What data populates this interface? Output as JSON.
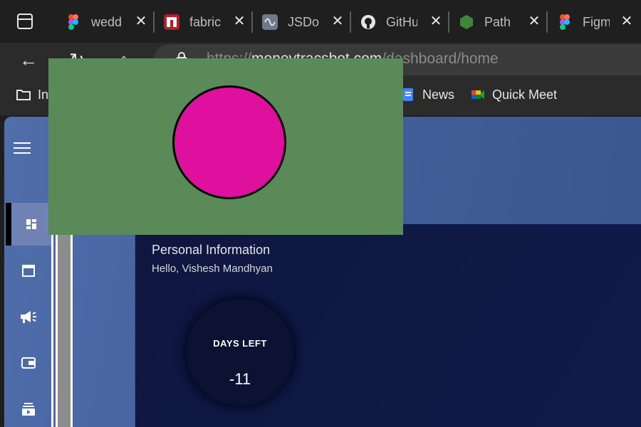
{
  "tabs": [
    {
      "label": "wedding",
      "icon": "figma-icon"
    },
    {
      "label": "fabric",
      "icon": "npm-icon"
    },
    {
      "label": "JSDoc",
      "icon": "jsdoc-icon"
    },
    {
      "label": "GitHub",
      "icon": "github-icon"
    },
    {
      "label": "Path",
      "icon": "nodejs-icon"
    },
    {
      "label": "Figma",
      "icon": "figma-icon"
    }
  ],
  "address_bar": {
    "scheme": "https://",
    "domain": "moneytracsbot.com",
    "path": "/dashboard/home"
  },
  "bookmarks": [
    {
      "label": "In",
      "icon": "folder-icon"
    },
    {
      "label": "News",
      "icon": "google-news-icon"
    },
    {
      "label": "Quick Meet",
      "icon": "google-meet-icon"
    }
  ],
  "sidebar": {
    "items": [
      {
        "name": "dashboard",
        "icon": "dashboard-icon",
        "active": true
      },
      {
        "name": "calendar",
        "icon": "calendar-icon",
        "active": false
      },
      {
        "name": "announcements",
        "icon": "megaphone-icon",
        "active": false
      },
      {
        "name": "wallet",
        "icon": "wallet-icon",
        "active": false
      },
      {
        "name": "subscriptions",
        "icon": "subscriptions-icon",
        "active": false
      }
    ]
  },
  "main": {
    "section_title": "Personal Information",
    "greeting": "Hello, Vishesh Mandhyan",
    "days_left_label": "DAYS LEFT",
    "days_left_value": "-11"
  },
  "colors": {
    "flag_green": "#5a8a58",
    "flag_disc": "#e0109e",
    "page_blue": "#4f6eaa",
    "card_navy": "#0f1640"
  }
}
